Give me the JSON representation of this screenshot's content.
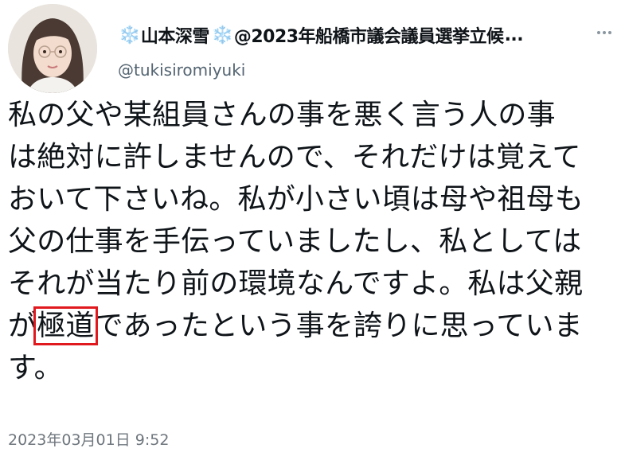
{
  "author": {
    "snow_icon": "❄️",
    "name": "山本深雪",
    "bio_title": "@2023年船橋市議会議員選挙立候",
    "ellipsis": "...",
    "handle": "@tukisiromiyuki"
  },
  "tweet": {
    "line1": "私の父や某組員さんの事を悪く言う人の事",
    "line2": "は絶対に許しませんので、それだけは覚えて",
    "line3": "おいて下さいね。私が小さい頃は母や祖母も",
    "line4": "父の仕事を手伝っていましたし、私としては",
    "line5": "それが当たり前の環境なんですよ。私は父親",
    "line6_pre": "が",
    "line6_highlight": "極道",
    "line6_post": "であったという事を誇りに思っていま",
    "line7": "す。"
  },
  "timestamp": "2023年03月01日 9:52",
  "colors": {
    "highlight_box": "#e0191f",
    "snow": "#5aaee8",
    "handle": "#536471"
  }
}
